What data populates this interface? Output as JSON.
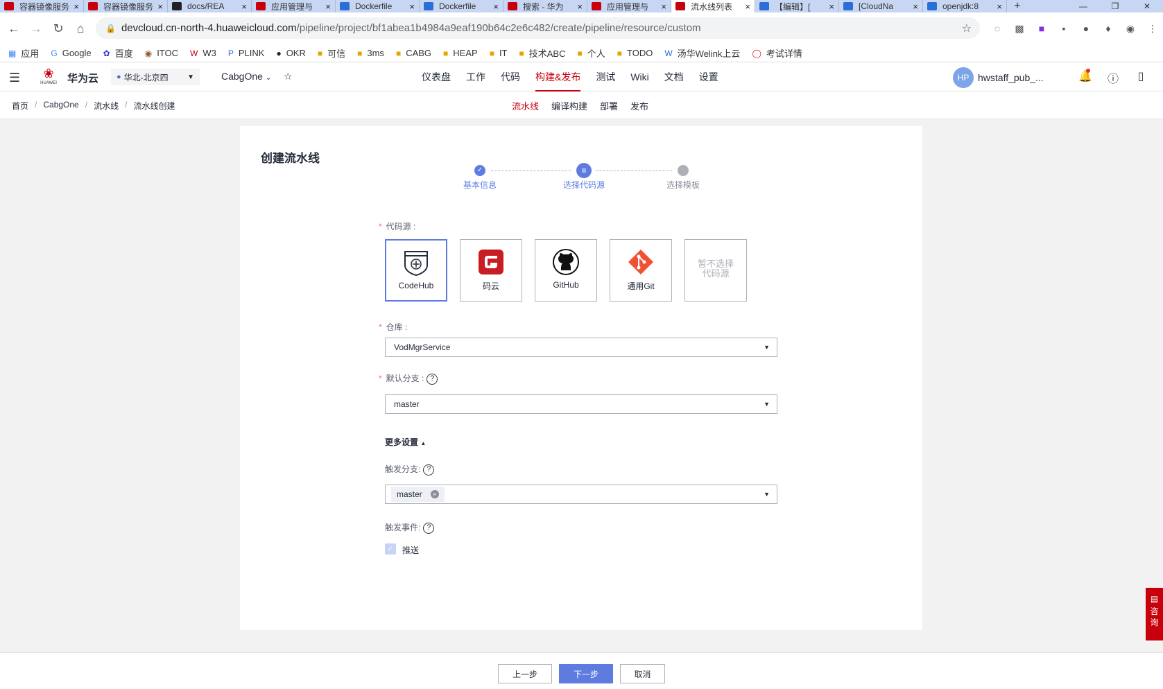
{
  "browser": {
    "tabs": [
      {
        "title": "容器镜像服务",
        "icon": "huawei-icon",
        "color": "#c7000b"
      },
      {
        "title": "容器镜像服务",
        "icon": "huawei-icon",
        "color": "#c7000b"
      },
      {
        "title": "docs/REA",
        "icon": "github-icon",
        "color": "#222222"
      },
      {
        "title": "应用管理与",
        "icon": "huawei-icon",
        "color": "#c7000b"
      },
      {
        "title": "Dockerfile",
        "icon": "edge-icon",
        "color": "#2b6fd6"
      },
      {
        "title": "Dockerfile",
        "icon": "edge-icon",
        "color": "#2b6fd6"
      },
      {
        "title": "搜索 - 华为",
        "icon": "huawei-icon",
        "color": "#c7000b"
      },
      {
        "title": "应用管理与",
        "icon": "huawei-icon",
        "color": "#c7000b"
      },
      {
        "title": "流水线列表",
        "icon": "huawei-icon",
        "color": "#c7000b",
        "active": true
      },
      {
        "title": "【编辑】[",
        "icon": "welink-icon",
        "color": "#2b6fd6"
      },
      {
        "title": "[CloudNa",
        "icon": "welink-icon",
        "color": "#2b6fd6"
      },
      {
        "title": "openjdk:8",
        "icon": "docker-icon",
        "color": "#2b6fd6"
      }
    ],
    "url_host": "devcloud.cn-north-4.huaweicloud.com",
    "url_path": "/pipeline/project/bf1abea1b4984a9eaf190b64c2e6c482/create/pipeline/resource/custom",
    "bookmarks": [
      {
        "label": "应用",
        "icon": "apps-grid-icon"
      },
      {
        "label": "Google",
        "icon": "google-icon"
      },
      {
        "label": "百度",
        "icon": "baidu-icon"
      },
      {
        "label": "ITOC",
        "icon": "itoc-icon"
      },
      {
        "label": "W3",
        "icon": "w3-icon"
      },
      {
        "label": "PLINK",
        "icon": "plink-icon"
      },
      {
        "label": "OKR",
        "icon": "okr-icon"
      },
      {
        "label": "可信",
        "icon": "folder-icon"
      },
      {
        "label": "3ms",
        "icon": "folder-icon"
      },
      {
        "label": "CABG",
        "icon": "folder-icon"
      },
      {
        "label": "HEAP",
        "icon": "folder-icon"
      },
      {
        "label": "IT",
        "icon": "folder-icon"
      },
      {
        "label": "技术ABC",
        "icon": "folder-icon"
      },
      {
        "label": "个人",
        "icon": "folder-icon"
      },
      {
        "label": "TODO",
        "icon": "folder-icon"
      },
      {
        "label": "汤华Welink上云",
        "icon": "welink-icon"
      },
      {
        "label": "考试详情",
        "icon": "exam-icon"
      }
    ]
  },
  "header": {
    "brand": "华为云",
    "logo_text": "HUAWEI",
    "region": "华北-北京四",
    "project": "CabgOne",
    "nav": [
      "仪表盘",
      "工作",
      "代码",
      "构建&发布",
      "测试",
      "Wiki",
      "文档",
      "设置"
    ],
    "nav_active": "构建&发布",
    "avatar": "HP",
    "username": "hwstaff_pub_..."
  },
  "subheader": {
    "breadcrumb": [
      "首页",
      "CabgOne",
      "流水线",
      "流水线创建"
    ],
    "tabs": [
      "流水线",
      "编译构建",
      "部署",
      "发布"
    ],
    "tab_active": "流水线"
  },
  "page": {
    "title": "创建流水线",
    "steps": [
      {
        "label": "基本信息",
        "state": "done"
      },
      {
        "label": "选择代码源",
        "state": "active"
      },
      {
        "label": "选择模板",
        "state": "todo"
      }
    ],
    "code_source_label": "代码源 :",
    "sources": [
      {
        "name": "CodeHub",
        "icon": "codehub-icon",
        "selected": true
      },
      {
        "name": "码云",
        "icon": "gitee-icon",
        "selected": false
      },
      {
        "name": "GitHub",
        "icon": "github-icon",
        "selected": false
      },
      {
        "name": "通用Git",
        "icon": "git-icon",
        "selected": false
      },
      {
        "name": "暂不选择代码源",
        "icon": "",
        "selected": false
      }
    ],
    "repo_label": "仓库 :",
    "repo_value": "VodMgrService",
    "branch_label": "默认分支 :",
    "branch_value": "master",
    "more_settings": "更多设置",
    "trigger_branch_label": "触发分支:",
    "trigger_branch_tag": "master",
    "trigger_event_label": "触发事件:",
    "trigger_event_option": "推送",
    "trigger_event_checked": true
  },
  "footer": {
    "prev": "上一步",
    "next": "下一步",
    "cancel": "取消"
  },
  "consult": "咨询",
  "colors": {
    "accent": "#5e7ce0",
    "brand_red": "#c7000b",
    "disabled": "#adb0b8"
  }
}
